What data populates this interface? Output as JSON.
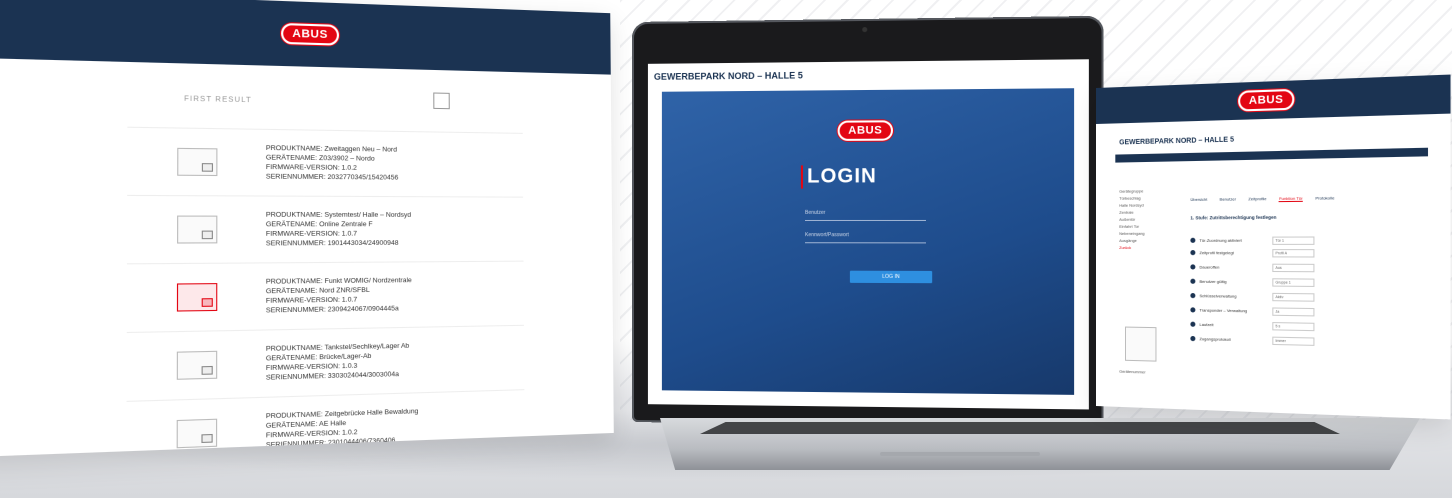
{
  "left_panel": {
    "logo": "ABUS",
    "search_label": "FIRST RESULT",
    "products": [
      {
        "lines": [
          "PRODUKTNAME: Zweitaggen Neu – Nord",
          "GERÄTENAME: Z03/3902 – Nordo",
          "FIRMWARE-VERSION: 1.0.2",
          "SERIENNUMMER: 2032770345/15420456"
        ]
      },
      {
        "lines": [
          "PRODUKTNAME: Systemtest/ Halle – Nordsyd",
          "GERÄTENAME: Online Zentrale F",
          "FIRMWARE-VERSION: 1.0.7",
          "SERIENNUMMER: 1901443034/24900948"
        ]
      },
      {
        "lines": [
          "PRODUKTNAME: Funkt WOMIG/ Nordzentrale",
          "GERÄTENAME: Nord ZNR/SFBL",
          "FIRMWARE-VERSION: 1.0.7",
          "SERIENNUMMER: 2309424067/0904445a"
        ]
      },
      {
        "lines": [
          "PRODUKTNAME: Tankstel/Sechlkey/Lager Ab",
          "GERÄTENAME: Brücke/Lager-Ab",
          "FIRMWARE-VERSION: 1.0.3",
          "SERIENNUMMER: 3303024044/3003004a"
        ]
      },
      {
        "lines": [
          "PRODUKTNAME: Zeitgebrücke Halle Bewaldung",
          "GERÄTENAME: AE Halle",
          "FIRMWARE-VERSION: 1.0.2",
          "SERIENNUMMER: 2301044406/7360406"
        ]
      }
    ]
  },
  "laptop": {
    "window_title": "GEWERBEPARK NORD – HALLE 5",
    "logo": "ABUS",
    "login_title": "LOGIN",
    "username_label": "Benutzer",
    "password_label": "Kennwort/Passwort",
    "login_button": "LOG IN"
  },
  "right_panel": {
    "logo": "ABUS",
    "page_title": "GEWERBEPARK NORD – HALLE 5",
    "sidebar": [
      "Gerätegruppe",
      "Türbeschlag",
      "Halle Nordsyd",
      "Zentrale",
      "Außentür",
      "Einfahrt Tor",
      "Nebeneingang",
      "Ausgänge"
    ],
    "sidebar_active": "Zurück",
    "tabs": [
      "Übersicht",
      "Benutzer",
      "Zeitprofile",
      "Funktion Tür",
      "Protokolle"
    ],
    "form_title": "1. Stufe: Zutrittsberechtigung festlegen",
    "form_rows": [
      {
        "label": "Tür-Zuordnung aktiviert",
        "value": "Tür 1"
      },
      {
        "label": "Zeitprofil festgelegt",
        "value": "Profil A"
      },
      {
        "label": "Daueroffen",
        "value": "Aus"
      },
      {
        "label": "Benutzer gültig",
        "value": "Gruppe 1"
      },
      {
        "label": "Schlüsselverwaltung",
        "value": "Aktiv"
      },
      {
        "label": "Transponder – Verwaltung",
        "value": "Ja"
      },
      {
        "label": "Laufzeit",
        "value": "5 s"
      },
      {
        "label": "Zugangsprotokoll",
        "value": "Immer"
      }
    ],
    "footer_label": "Gerätenummer"
  }
}
